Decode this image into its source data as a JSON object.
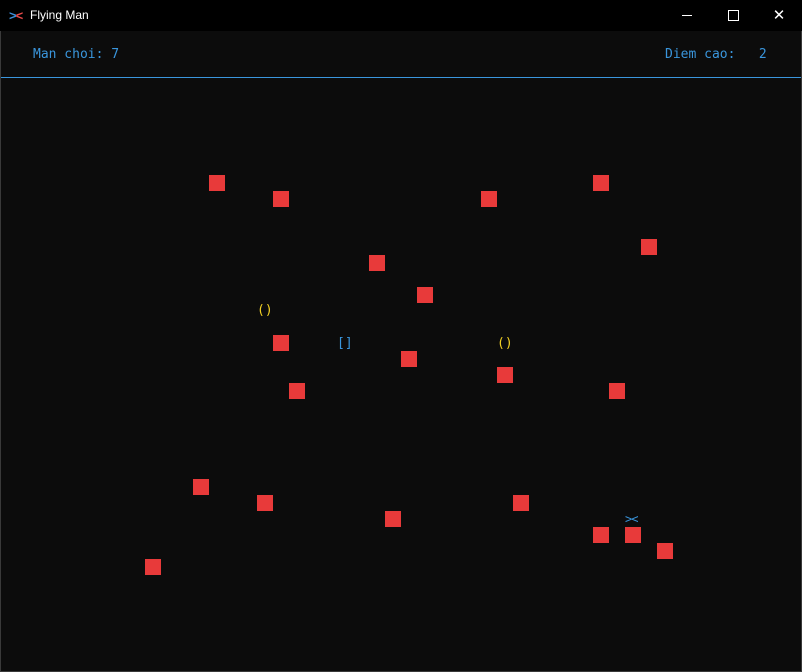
{
  "window": {
    "title": "Flying Man",
    "icon_left": ">",
    "icon_right": "<",
    "close_glyph": "✕"
  },
  "hud": {
    "level_text": "Man choi: 7",
    "score_text": "Diem cao:   2"
  },
  "colors": {
    "background": "#0c0c0c",
    "accent": "#3a96dd",
    "obstacle": "#e83a3a",
    "pickup": "#f2d023"
  },
  "pickups": {
    "ring_glyph": "()",
    "shield_glyph": "[]"
  },
  "player": {
    "glyph": "><"
  }
}
